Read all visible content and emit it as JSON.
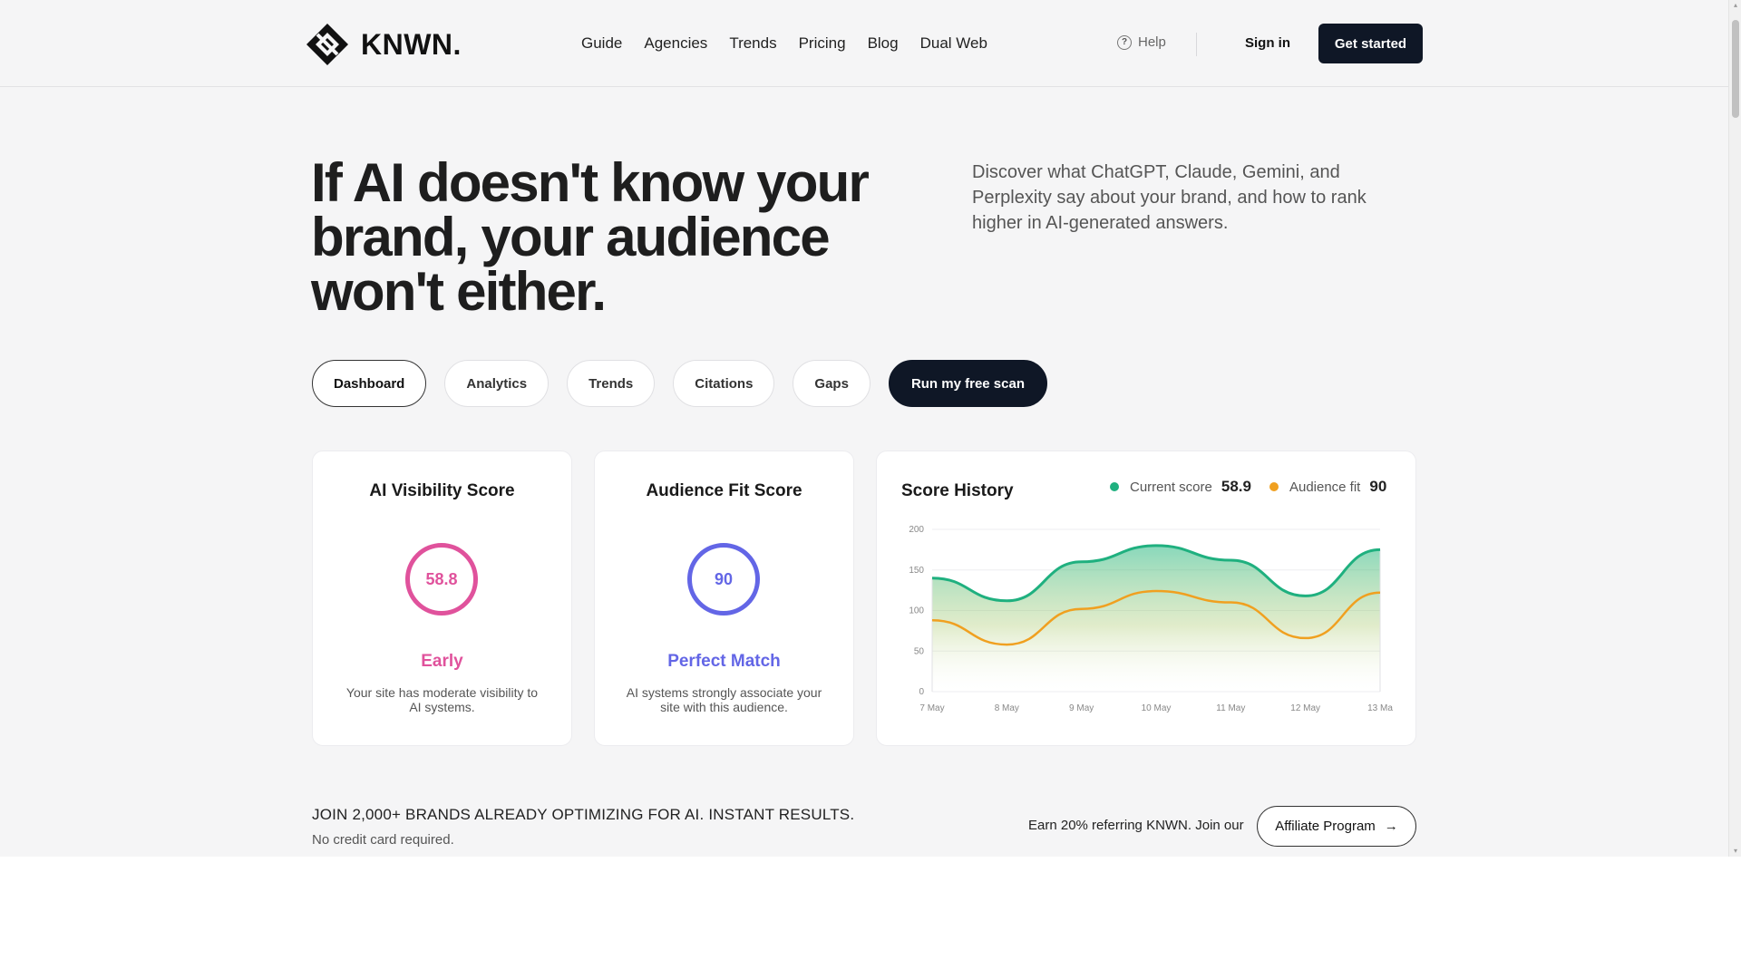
{
  "brand": {
    "name": "KNWN."
  },
  "nav": {
    "items": [
      {
        "label": "Guide"
      },
      {
        "label": "Agencies"
      },
      {
        "label": "Trends"
      },
      {
        "label": "Pricing"
      },
      {
        "label": "Blog"
      },
      {
        "label": "Dual Web"
      }
    ],
    "help_label": "Help",
    "signin_label": "Sign in",
    "get_started_label": "Get started"
  },
  "hero": {
    "title": "If AI doesn't know your brand, your audience won't either.",
    "subtitle": "Discover what ChatGPT, Claude, Gemini, and Perplexity say about your brand, and how to rank higher in AI-generated answers."
  },
  "tabs": [
    {
      "label": "Dashboard",
      "active": true
    },
    {
      "label": "Analytics"
    },
    {
      "label": "Trends"
    },
    {
      "label": "Citations"
    },
    {
      "label": "Gaps"
    }
  ],
  "cta": {
    "label": "Run my free scan"
  },
  "cards": {
    "visibility": {
      "title": "AI Visibility Score",
      "score": "58.8",
      "label": "Early",
      "description": "Your site has moderate visibility to AI systems.",
      "color": "#e0529c"
    },
    "audience": {
      "title": "Audience Fit Score",
      "score": "90",
      "label": "Perfect Match",
      "description": "AI systems strongly associate your site with this audience.",
      "color": "#6366e6"
    }
  },
  "history": {
    "title": "Score History",
    "legend": [
      {
        "label": "Current score",
        "value": "58.9",
        "color": "#1fb07f"
      },
      {
        "label": "Audience fit",
        "value": "90",
        "color": "#f0a020"
      }
    ]
  },
  "chart_data": {
    "type": "area",
    "title": "Score History",
    "categories": [
      "7 May",
      "8 May",
      "9 May",
      "10 May",
      "11 May",
      "12 May",
      "13 Ma"
    ],
    "ylim": [
      0,
      200
    ],
    "yticks": [
      0,
      50,
      100,
      150,
      200
    ],
    "grid": true,
    "legend_position": "top-right",
    "series": [
      {
        "name": "Current score",
        "color": "#1fb07f",
        "values": [
          140,
          112,
          160,
          180,
          162,
          118,
          175
        ]
      },
      {
        "name": "Audience fit",
        "color": "#f0a020",
        "values": [
          88,
          58,
          102,
          124,
          110,
          66,
          122
        ]
      }
    ]
  },
  "footer": {
    "join_text": "JOIN 2,000+ BRANDS ALREADY OPTIMIZING FOR AI. INSTANT RESULTS.",
    "no_card_text": "No credit card required.",
    "earn_text": "Earn 20% referring KNWN. Join our",
    "affiliate_label": "Affiliate Program"
  }
}
